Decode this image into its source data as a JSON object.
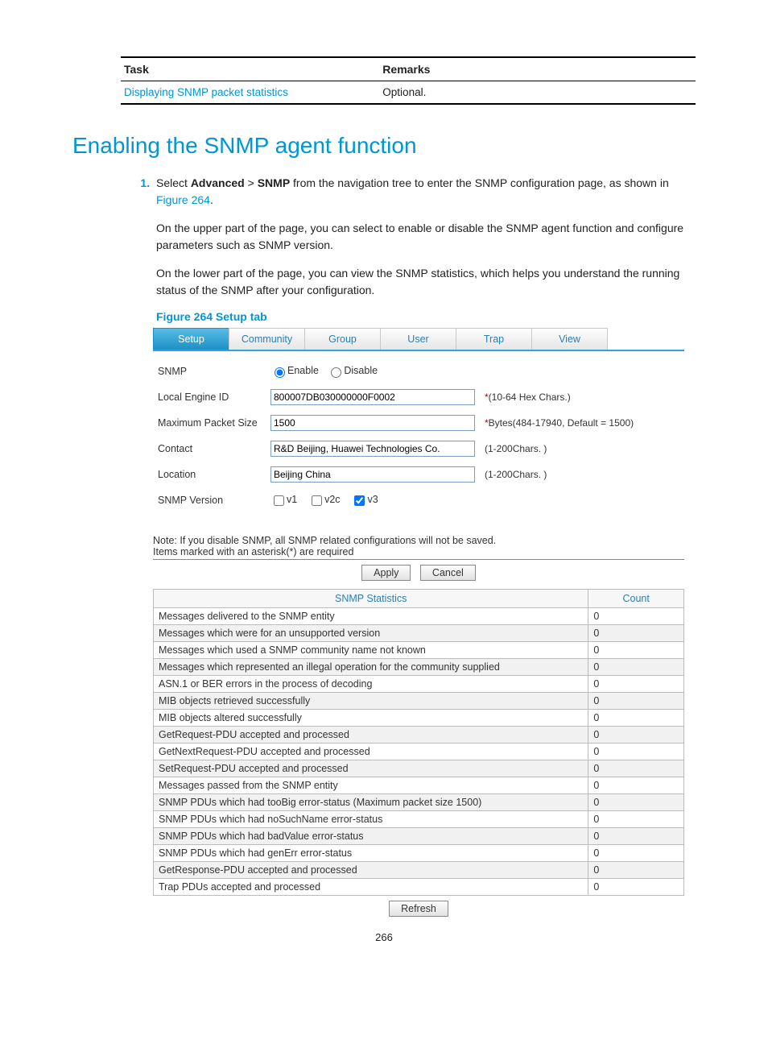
{
  "mini_table": {
    "headers": [
      "Task",
      "Remarks"
    ],
    "link": "Displaying SNMP packet statistics",
    "remark": "Optional."
  },
  "heading": "Enabling the SNMP agent function",
  "step": {
    "num": "1.",
    "p1a": "Select ",
    "p1b": "Advanced",
    "p1c": " > ",
    "p1d": "SNMP",
    "p1e": " from the navigation tree to enter the SNMP configuration page, as shown in ",
    "p1link": "Figure 264",
    "p1f": ".",
    "p2": "On the upper part of the page, you can select to enable or disable the SNMP agent function and configure parameters such as SNMP version.",
    "p3": "On the lower part of the page, you can view the SNMP statistics, which helps you understand the running status of the SNMP after your configuration."
  },
  "figure_caption": "Figure 264 Setup tab",
  "tabs": [
    "Setup",
    "Community",
    "Group",
    "User",
    "Trap",
    "View"
  ],
  "form": {
    "snmp_label": "SNMP",
    "enable": "Enable",
    "disable": "Disable",
    "engine_label": "Local Engine ID",
    "engine_value": "800007DB030000000F0002",
    "engine_hint_ast": "*",
    "engine_hint": "(10-64 Hex Chars.)",
    "max_label": "Maximum Packet Size",
    "max_value": "1500",
    "max_hint_ast": "*",
    "max_hint": "Bytes(484-17940, Default = 1500)",
    "contact_label": "Contact",
    "contact_value": "R&D Beijing, Huawei Technologies Co.",
    "contact_hint": "(1-200Chars. )",
    "loc_label": "Location",
    "loc_value": "Beijing China",
    "loc_hint": "(1-200Chars. )",
    "ver_label": "SNMP Version",
    "v1": "v1",
    "v2c": "v2c",
    "v3": "v3"
  },
  "notes": {
    "n1": "Note: If you disable SNMP, all SNMP related configurations will not be saved.",
    "n2": "Items marked with an asterisk(*) are required"
  },
  "buttons": {
    "apply": "Apply",
    "cancel": "Cancel",
    "refresh": "Refresh"
  },
  "stats_header": {
    "c1": "SNMP Statistics",
    "c2": "Count"
  },
  "stats": [
    {
      "label": "Messages delivered to the SNMP entity",
      "count": "0"
    },
    {
      "label": "Messages which were for an unsupported version",
      "count": "0"
    },
    {
      "label": "Messages which used a SNMP community name not known",
      "count": "0"
    },
    {
      "label": "Messages which represented an illegal operation for the community supplied",
      "count": "0"
    },
    {
      "label": "ASN.1 or BER errors in the process of decoding",
      "count": "0"
    },
    {
      "label": "MIB objects retrieved successfully",
      "count": "0"
    },
    {
      "label": "MIB objects altered successfully",
      "count": "0"
    },
    {
      "label": "GetRequest-PDU accepted and processed",
      "count": "0"
    },
    {
      "label": "GetNextRequest-PDU accepted and processed",
      "count": "0"
    },
    {
      "label": "SetRequest-PDU accepted and processed",
      "count": "0"
    },
    {
      "label": "Messages passed from the SNMP entity",
      "count": "0"
    },
    {
      "label": "SNMP PDUs which had tooBig error-status (Maximum packet size 1500)",
      "count": "0"
    },
    {
      "label": "SNMP PDUs which had noSuchName error-status",
      "count": "0"
    },
    {
      "label": "SNMP PDUs which had badValue error-status",
      "count": "0"
    },
    {
      "label": "SNMP PDUs which had genErr error-status",
      "count": "0"
    },
    {
      "label": "GetResponse-PDU accepted and processed",
      "count": "0"
    },
    {
      "label": "Trap PDUs accepted and processed",
      "count": "0"
    }
  ],
  "page_number": "266"
}
